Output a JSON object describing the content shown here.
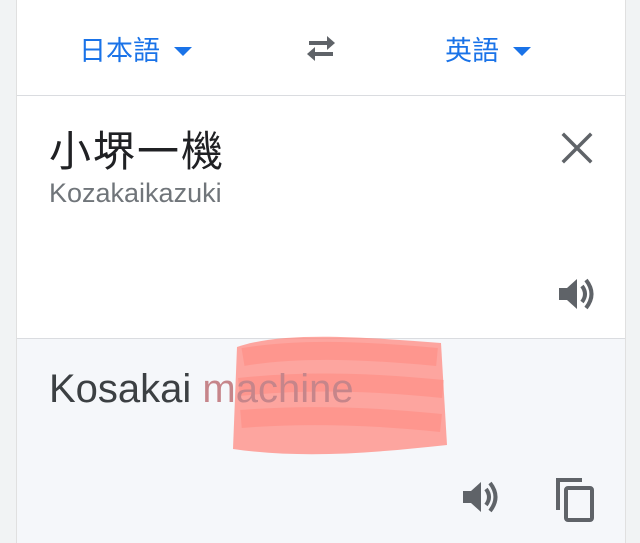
{
  "language_bar": {
    "source_language": "日本語",
    "target_language": "英語",
    "caret_icon": "caret-down-icon",
    "swap_icon": "swap-arrows-icon"
  },
  "input": {
    "source_text": "小堺一機",
    "romanization": "Kozakaikazuki",
    "clear_icon": "close-icon",
    "speaker_icon": "speaker-icon"
  },
  "output": {
    "translation_part1": "Kosakai ",
    "translation_part2": "machine",
    "speaker_icon": "speaker-icon",
    "copy_icon": "copy-icon"
  },
  "colors": {
    "accent": "#1a73e8",
    "icon_gray": "#5f6368",
    "scribble": "#ff8a80"
  }
}
